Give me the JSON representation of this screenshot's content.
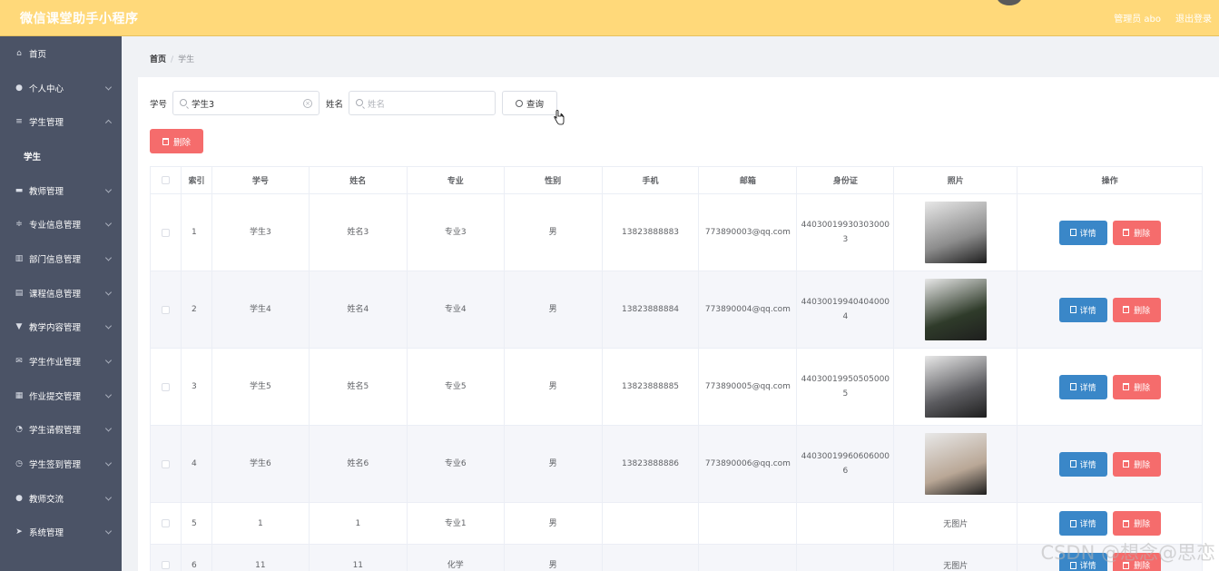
{
  "header": {
    "title": "微信课堂助手小程序",
    "admin": "管理员 abo",
    "logout": "退出登录"
  },
  "sidebar": {
    "items": [
      {
        "label": "首页",
        "icon": "home-icon",
        "chevron": "none"
      },
      {
        "label": "个人中心",
        "icon": "user-icon",
        "chevron": "down"
      },
      {
        "label": "学生管理",
        "icon": "list-icon",
        "chevron": "up"
      },
      {
        "label": "学生",
        "icon": "",
        "chevron": "none",
        "sub": true
      },
      {
        "label": "教师管理",
        "icon": "briefcase-icon",
        "chevron": "down"
      },
      {
        "label": "专业信息管理",
        "icon": "sliders-icon",
        "chevron": "down"
      },
      {
        "label": "部门信息管理",
        "icon": "bar-chart-icon",
        "chevron": "down"
      },
      {
        "label": "课程信息管理",
        "icon": "document-icon",
        "chevron": "down"
      },
      {
        "label": "教学内容管理",
        "icon": "chat-icon",
        "chevron": "down"
      },
      {
        "label": "学生作业管理",
        "icon": "mail-icon",
        "chevron": "down"
      },
      {
        "label": "作业提交管理",
        "icon": "grid-icon",
        "chevron": "down"
      },
      {
        "label": "学生请假管理",
        "icon": "compass-icon",
        "chevron": "down"
      },
      {
        "label": "学生签到管理",
        "icon": "clock-icon",
        "chevron": "down"
      },
      {
        "label": "教师交流",
        "icon": "user-icon",
        "chevron": "down"
      },
      {
        "label": "系统管理",
        "icon": "send-icon",
        "chevron": "down"
      }
    ]
  },
  "breadcrumb": {
    "home": "首页",
    "sep": "/",
    "current": "学生"
  },
  "search": {
    "xuehao_label": "学号",
    "xuehao_value": "学生3",
    "xingming_label": "姓名",
    "xingming_placeholder": "姓名",
    "query_label": "查询"
  },
  "delete_label": "删除",
  "table": {
    "headers": [
      "",
      "索引",
      "学号",
      "姓名",
      "专业",
      "性别",
      "手机",
      "邮箱",
      "身份证",
      "照片",
      "操作"
    ],
    "detail_label": "详情",
    "delete_label": "删除",
    "no_photo": "无图片",
    "rows": [
      {
        "idx": "1",
        "xuehao": "学生3",
        "name": "姓名3",
        "major": "专业3",
        "gender": "男",
        "phone": "13823888883",
        "email": "773890003@qq.com",
        "id": "440300199303030003",
        "photo": "photo-1",
        "photo_color": "#8c8c8c"
      },
      {
        "idx": "2",
        "xuehao": "学生4",
        "name": "姓名4",
        "major": "专业4",
        "gender": "男",
        "phone": "13823888884",
        "email": "773890004@qq.com",
        "id": "440300199404040004",
        "photo": "photo-2",
        "photo_color": "#2f3b2a"
      },
      {
        "idx": "3",
        "xuehao": "学生5",
        "name": "姓名5",
        "major": "专业5",
        "gender": "男",
        "phone": "13823888885",
        "email": "773890005@qq.com",
        "id": "440300199505050005",
        "photo": "photo-3",
        "photo_color": "#5b5b5f"
      },
      {
        "idx": "4",
        "xuehao": "学生6",
        "name": "姓名6",
        "major": "专业6",
        "gender": "男",
        "phone": "13823888886",
        "email": "773890006@qq.com",
        "id": "440300199606060006",
        "photo": "photo-4",
        "photo_color": "#b9a796"
      },
      {
        "idx": "5",
        "xuehao": "1",
        "name": "1",
        "major": "专业1",
        "gender": "男",
        "phone": "",
        "email": "",
        "id": "",
        "photo": "none"
      },
      {
        "idx": "6",
        "xuehao": "11",
        "name": "11",
        "major": "化学",
        "gender": "男",
        "phone": "",
        "email": "",
        "id": "",
        "photo": "none"
      }
    ]
  },
  "watermark": "CSDN @想念@思恋",
  "colors": {
    "header": "#ffd97a",
    "sidebar": "#4b5366",
    "danger": "#f56c6c",
    "primary": "#3a87c8"
  }
}
